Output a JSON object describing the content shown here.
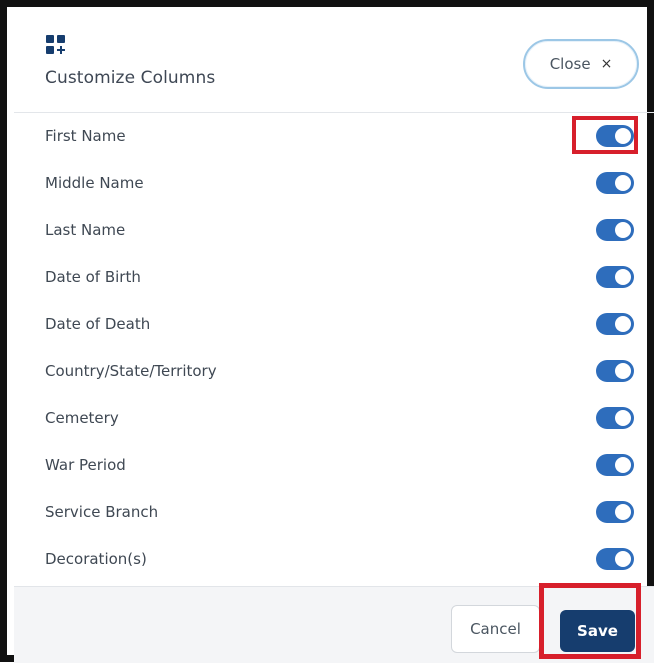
{
  "dialog": {
    "title": "Customize Columns",
    "title_icon": "grid-plus-icon",
    "close_label": "Close",
    "close_icon": "×"
  },
  "columns": [
    {
      "label": "First Name",
      "enabled": true
    },
    {
      "label": "Middle Name",
      "enabled": true
    },
    {
      "label": "Last Name",
      "enabled": true
    },
    {
      "label": "Date of Birth",
      "enabled": true
    },
    {
      "label": "Date of Death",
      "enabled": true
    },
    {
      "label": "Country/State/Territory",
      "enabled": true
    },
    {
      "label": "Cemetery",
      "enabled": true
    },
    {
      "label": "War Period",
      "enabled": true
    },
    {
      "label": "Service Branch",
      "enabled": true
    },
    {
      "label": "Decoration(s)",
      "enabled": true
    }
  ],
  "footer": {
    "cancel_label": "Cancel",
    "save_label": "Save"
  },
  "colors": {
    "toggle_on": "#2e6dbc",
    "save_button": "#163d6e",
    "highlight": "#d71f2b",
    "close_border": "#9cc7e6"
  }
}
